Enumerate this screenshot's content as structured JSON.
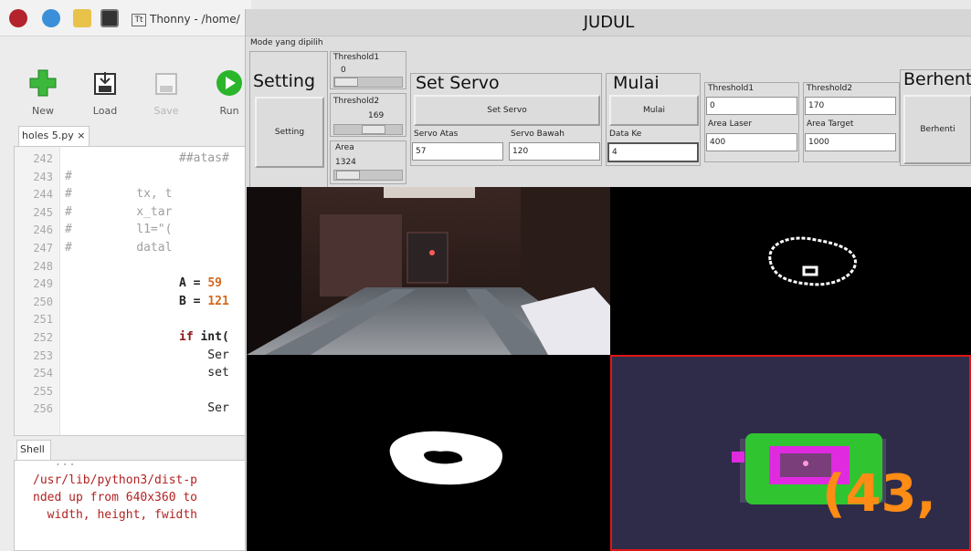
{
  "thonny": {
    "task_label": "Thonny - /home/",
    "tt_glyph": "Tt",
    "toolbar": [
      {
        "label": "New",
        "icon": "plus-icon"
      },
      {
        "label": "Load",
        "icon": "load-icon"
      },
      {
        "label": "Save",
        "icon": "save-icon"
      },
      {
        "label": "Run",
        "icon": "run-icon"
      }
    ],
    "editor_tab": "holes 5.py ×",
    "lines": [
      {
        "n": "242",
        "c": "##atas#"
      },
      {
        "n": "243",
        "c": "#"
      },
      {
        "n": "244",
        "c": "#         tx, t"
      },
      {
        "n": "245",
        "c": "#         x_tar"
      },
      {
        "n": "246",
        "c": "#         l1=\"("
      },
      {
        "n": "247",
        "c": "#         datal"
      },
      {
        "n": "248",
        "c": ""
      },
      {
        "n": "249",
        "c": "A = 59"
      },
      {
        "n": "250",
        "c": "B = 121"
      },
      {
        "n": "251",
        "c": ""
      },
      {
        "n": "252",
        "c": "if int("
      },
      {
        "n": "253",
        "c": "    Ser"
      },
      {
        "n": "254",
        "c": "    set"
      },
      {
        "n": "255",
        "c": ""
      },
      {
        "n": "256",
        "c": "    Ser"
      }
    ],
    "shell_tab": "Shell",
    "shell_lines": [
      "/usr/lib/python3/dist-p",
      "nded up from 640x360 to",
      "  width, height, fwidth"
    ]
  },
  "judul": {
    "title": "JUDUL",
    "mode_label": "Mode yang dipilih",
    "setting": {
      "big": "Setting",
      "button": "Setting"
    },
    "threshold1": {
      "label": "Threshold1",
      "value": "0",
      "level": 0.0
    },
    "threshold2": {
      "label": "Threshold2",
      "value": "169",
      "level": 0.66
    },
    "area": {
      "label": "Area",
      "value": "1324",
      "level": 0.05
    },
    "set_servo": {
      "big": "Set Servo",
      "button": "Set Servo"
    },
    "servo_atas": {
      "label": "Servo Atas",
      "value": "57"
    },
    "servo_bawah": {
      "label": "Servo Bawah",
      "value": "120"
    },
    "mulai": {
      "big": "Mulai",
      "button": "Mulai"
    },
    "data_ke": {
      "label": "Data Ke",
      "value": "4"
    },
    "thr1_field": {
      "label": "Threshold1",
      "value": "0"
    },
    "thr2_field": {
      "label": "Threshold2",
      "value": "170"
    },
    "area_laser": {
      "label": "Area Laser",
      "value": "400"
    },
    "area_target": {
      "label": "Area Target",
      "value": "1000"
    },
    "berhenti": {
      "big": "Berhent",
      "button": "Berhenti"
    }
  },
  "overlay_text": "(43,",
  "colors": {
    "accent_green": "#31c431",
    "target_magenta": "#e02ae0",
    "overlay_orange": "#ff8c14",
    "red_border": "#e01616"
  }
}
